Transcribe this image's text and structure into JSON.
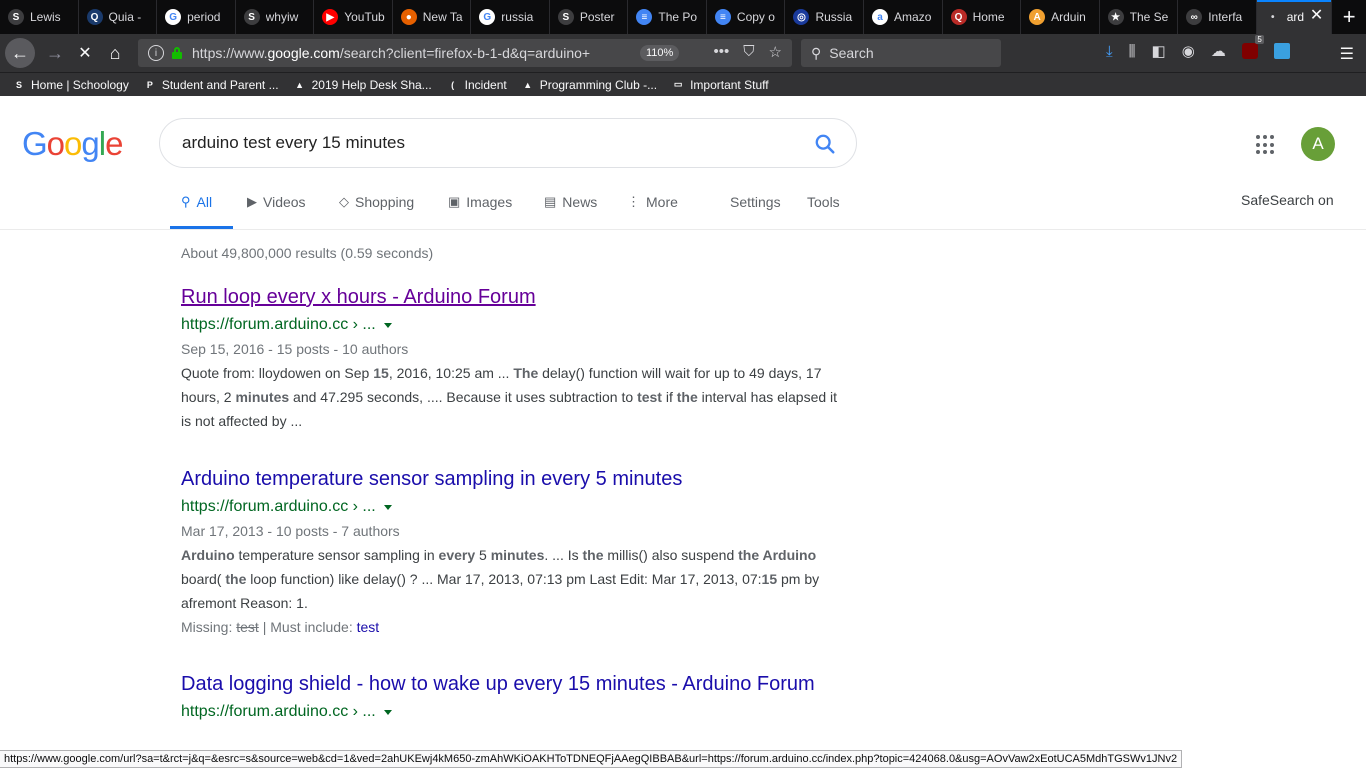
{
  "browser": {
    "tabs": [
      {
        "title": "Lewis",
        "favicon": "S",
        "color": "#3d3d3f"
      },
      {
        "title": "Quia -",
        "favicon": "Q",
        "color": "#1a3a6b"
      },
      {
        "title": "period",
        "favicon": "G",
        "color": "#ffffff"
      },
      {
        "title": "whyiw",
        "favicon": "S",
        "color": "#3d3d3f"
      },
      {
        "title": "YouTub",
        "favicon": "▶",
        "color": "#ff0000"
      },
      {
        "title": "New Ta",
        "favicon": "●",
        "color": "#e66000"
      },
      {
        "title": "russia",
        "favicon": "G",
        "color": "#ffffff"
      },
      {
        "title": "Poster",
        "favicon": "S",
        "color": "#3d3d3f"
      },
      {
        "title": "The Po",
        "favicon": "≡",
        "color": "#4285f4"
      },
      {
        "title": "Copy o",
        "favicon": "≡",
        "color": "#4285f4"
      },
      {
        "title": "Russia",
        "favicon": "◎",
        "color": "#1a3a9b"
      },
      {
        "title": "Amazo",
        "favicon": "a",
        "color": "#ffffff"
      },
      {
        "title": "Home",
        "favicon": "Q",
        "color": "#b92b27"
      },
      {
        "title": "Arduin",
        "favicon": "A",
        "color": "#f0a030"
      },
      {
        "title": "The Se",
        "favicon": "★",
        "color": "#3d3d3f"
      },
      {
        "title": "Interfa",
        "favicon": "∞",
        "color": "#3d3d3f"
      }
    ],
    "active_tab": {
      "title": "ard",
      "dot": "•"
    },
    "new_tab": "+",
    "url_prefix": "https://www.",
    "url_domain": "google.com",
    "url_rest": "/search?client=firefox-b-1-d&q=arduino+",
    "zoom": "110%",
    "search_placeholder": "Search",
    "ublock_count": "5"
  },
  "bookmarks": [
    {
      "label": "Home | Schoology",
      "icon": "S"
    },
    {
      "label": "Student and Parent ...",
      "icon": "P"
    },
    {
      "label": "2019 Help Desk Sha...",
      "icon": "▲"
    },
    {
      "label": "Incident",
      "icon": "("
    },
    {
      "label": "Programming Club -...",
      "icon": "▲"
    },
    {
      "label": "Important Stuff",
      "icon": "▭"
    }
  ],
  "google": {
    "logo": [
      "G",
      "o",
      "o",
      "g",
      "l",
      "e"
    ],
    "query": "arduino test every 15 minutes",
    "avatar_letter": "A",
    "tabs": [
      {
        "label": "All",
        "icon": "⚲"
      },
      {
        "label": "Videos",
        "icon": "▶"
      },
      {
        "label": "Shopping",
        "icon": "◇"
      },
      {
        "label": "Images",
        "icon": "▣"
      },
      {
        "label": "News",
        "icon": "▤"
      },
      {
        "label": "More",
        "icon": "⋮"
      }
    ],
    "settings": "Settings",
    "tools": "Tools",
    "safesearch": "SafeSearch on",
    "stats": "About 49,800,000 results (0.59 seconds)"
  },
  "results": [
    {
      "title": "Run loop every x hours - Arduino Forum",
      "url": "https://forum.arduino.cc › ...",
      "date": "Sep 15, 2016 - 15 posts - 10 authors",
      "snippet": "Quote from: lloydowen on Sep <b>15</b>, 2016, 10:25 am ... <b>The</b> delay() function will wait for up to 49 days, 17 hours, 2 <b>minutes</b> and 47.295 seconds, .... Because it uses subtraction to <b>test</b> if <b>the</b> interval has elapsed it is not affected by ..."
    },
    {
      "title": "Arduino temperature sensor sampling in every 5 minutes",
      "url": "https://forum.arduino.cc › ...",
      "date": "Mar 17, 2013 - 10 posts - 7 authors",
      "snippet": "<b>Arduino</b> temperature sensor sampling in <b>every</b> 5 <b>minutes</b>. ... Is <b>the</b> millis() also suspend <b>the Arduino</b> board( <b>the</b> loop function) like delay() ? ... Mar 17, 2013, 07:13 pm Last Edit: Mar 17, 2013, 07:<b>15</b> pm by afremont Reason: 1.",
      "missing_label": "Missing:",
      "missing_term": "test",
      "must_include_label": "| Must include:",
      "must_include_term": "test"
    },
    {
      "title": "Data logging shield - how to wake up every 15 minutes - Arduino Forum",
      "url": "https://forum.arduino.cc › ..."
    }
  ],
  "status_url": "https://www.google.com/url?sa=t&rct=j&q=&esrc=s&source=web&cd=1&ved=2ahUKEwj4kM650-zmAhWKiOAKHToTDNEQFjAAegQIBBAB&url=https://forum.arduino.cc/index.php?topic=424068.0&usg=AOvVaw2xEotUCA5MdhTGSWv1JNv2"
}
